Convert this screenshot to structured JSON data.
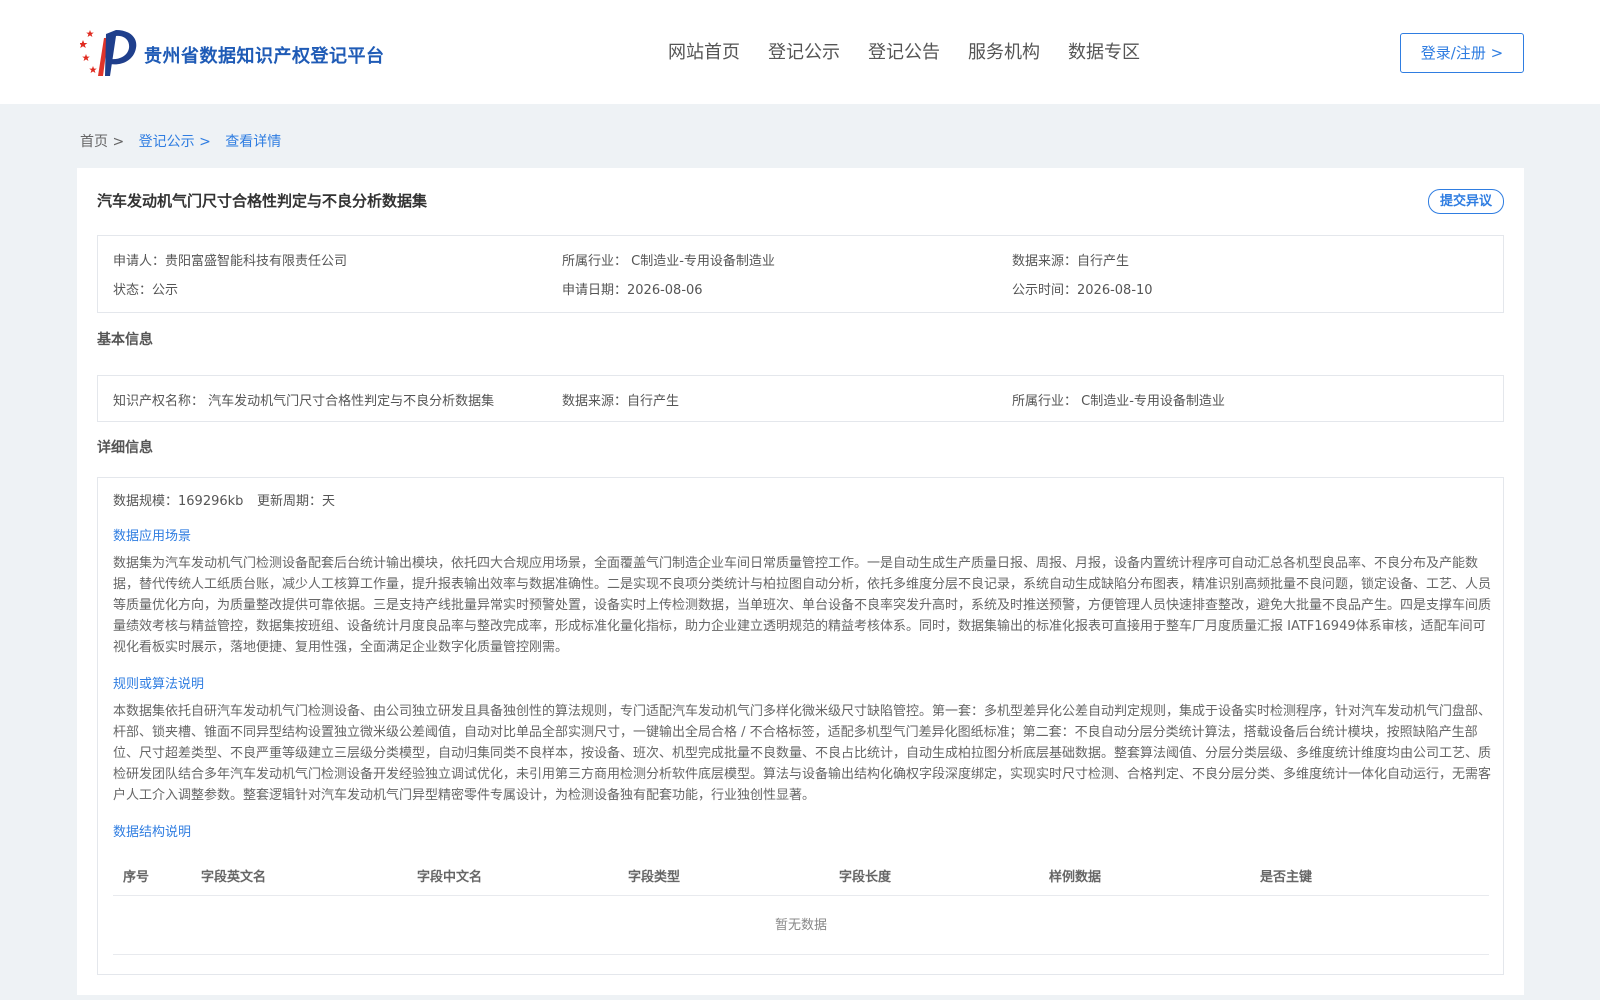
{
  "header": {
    "site_title": "贵州省数据知识产权登记平台",
    "nav": [
      "网站首页",
      "登记公示",
      "登记公告",
      "服务机构",
      "数据专区"
    ],
    "login_label": "登录/注册 >"
  },
  "breadcrumb": {
    "home": "首页 >",
    "section": "登记公示 >",
    "current": "查看详情"
  },
  "record": {
    "title": "汽车发动机气门尺寸合格性判定与不良分析数据集",
    "objection_label": "提交异议",
    "summary": {
      "applicant": "申请人：贵阳富盛智能科技有限责任公司",
      "industry": "所属行业： C制造业-专用设备制造业",
      "source": "数据来源：自行产生",
      "status": "状态：公示",
      "apply_date": "申请日期：2026-08-06",
      "publish_time": "公示时间：2026-08-10"
    }
  },
  "basic_info": {
    "heading": "基本信息",
    "ip_name": "知识产权名称： 汽车发动机气门尺寸合格性判定与不良分析数据集",
    "source": "数据来源：自行产生",
    "industry": "所属行业： C制造业-专用设备制造业"
  },
  "detail_info": {
    "heading": "详细信息",
    "scale": "数据规模：169296kb",
    "update_cycle": "更新周期：天",
    "scenario_title": "数据应用场景",
    "scenario_text": "数据集为汽车发动机气门检测设备配套后台统计输出模块，依托四大合规应用场景，全面覆盖气门制造企业车间日常质量管控工作。一是自动生成生产质量日报、周报、月报，设备内置统计程序可自动汇总各机型良品率、不良分布及产能数据，替代传统人工纸质台账，减少人工核算工作量，提升报表输出效率与数据准确性。二是实现不良项分类统计与柏拉图自动分析，依托多维度分层不良记录，系统自动生成缺陷分布图表，精准识别高频批量不良问题，锁定设备、工艺、人员等质量优化方向，为质量整改提供可靠依据。三是支持产线批量异常实时预警处置，设备实时上传检测数据，当单班次、单台设备不良率突发升高时，系统及时推送预警，方便管理人员快速排查整改，避免大批量不良品产生。四是支撑车间质量绩效考核与精益管控，数据集按班组、设备统计月度良品率与整改完成率，形成标准化量化指标，助力企业建立透明规范的精益考核体系。同时，数据集输出的标准化报表可直接用于整车厂月度质量汇报 IATF16949体系审核，适配车间可视化看板实时展示，落地便捷、复用性强，全面满足企业数字化质量管控刚需。",
    "algorithm_title": "规则或算法说明",
    "algorithm_text": "本数据集依托自研汽车发动机气门检测设备、由公司独立研发且具备独创性的算法规则，专门适配汽车发动机气门多样化微米级尺寸缺陷管控。第一套：多机型差异化公差自动判定规则，集成于设备实时检测程序，针对汽车发动机气门盘部、杆部、锁夹槽、锥面不同异型结构设置独立微米级公差阈值，自动对比单品全部实测尺寸，一键输出全局合格 / 不合格标签，适配多机型气门差异化图纸标准；第二套：不良自动分层分类统计算法，搭载设备后台统计模块，按照缺陷产生部位、尺寸超差类型、不良严重等级建立三层级分类模型，自动归集同类不良样本，按设备、班次、机型完成批量不良数量、不良占比统计，自动生成柏拉图分析底层基础数据。整套算法阈值、分层分类层级、多维度统计维度均由公司工艺、质检研发团队结合多年汽车发动机气门检测设备开发经验独立调试优化，未引用第三方商用检测分析软件底层模型。算法与设备输出结构化确权字段深度绑定，实现实时尺寸检测、合格判定、不良分层分类、多维度统计一体化自动运行，无需客户人工介入调整参数。整套逻辑针对汽车发动机气门异型精密零件专属设计，为检测设备独有配套功能，行业独创性显著。",
    "structure_title": "数据结构说明",
    "table_headers": [
      "序号",
      "字段英文名",
      "字段中文名",
      "字段类型",
      "字段长度",
      "样例数据",
      "是否主键"
    ],
    "empty_text": "暂无数据"
  }
}
